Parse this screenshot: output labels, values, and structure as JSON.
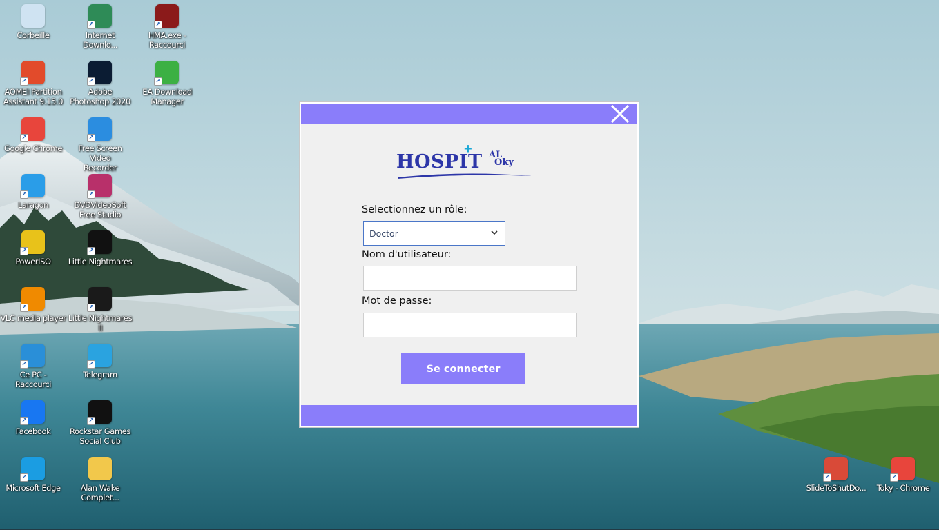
{
  "desktop": {
    "icons": [
      {
        "label": "Corbeille",
        "icon": "recycle-bin-icon",
        "color": "#cfe3f2"
      },
      {
        "label": "Internet\nDownlo...",
        "icon": "idm-icon",
        "color": "#2e8b57"
      },
      {
        "label": "HMA.exe -\nRaccourci",
        "icon": "hma-icon",
        "color": "#8b1a1a"
      },
      {
        "label": "AOMEI Partition\nAssistant 9.15.0",
        "icon": "aomei-icon",
        "color": "#e24b2b"
      },
      {
        "label": "Adobe\nPhotoshop 2020",
        "icon": "photoshop-icon",
        "color": "#0b1c33"
      },
      {
        "label": "EA Download\nManager",
        "icon": "ea-icon",
        "color": "#3cb043"
      },
      {
        "label": "Google Chrome",
        "icon": "chrome-icon",
        "color": "#e8453c"
      },
      {
        "label": "Free Screen Video\nRecorder",
        "icon": "screen-recorder-icon",
        "color": "#2b8de0"
      },
      {
        "label": "Laragon",
        "icon": "laragon-icon",
        "color": "#2a9de8"
      },
      {
        "label": "DVDVideoSoft\nFree Studio",
        "icon": "dvdvideosoft-icon",
        "color": "#b8306a"
      },
      {
        "label": "PowerISO",
        "icon": "poweriso-icon",
        "color": "#e8c21a"
      },
      {
        "label": "Little Nightmares",
        "icon": "little-nightmares-icon",
        "color": "#111111"
      },
      {
        "label": "VLC media player",
        "icon": "vlc-icon",
        "color": "#f08a00"
      },
      {
        "label": "Little Nightmares\nII",
        "icon": "little-nightmares-2-icon",
        "color": "#1a1a1a"
      },
      {
        "label": "Ce PC -\nRaccourci",
        "icon": "this-pc-icon",
        "color": "#2a8fd8"
      },
      {
        "label": "Telegram",
        "icon": "telegram-icon",
        "color": "#2aa3e0"
      },
      {
        "label": "Facebook",
        "icon": "facebook-icon",
        "color": "#1877f2"
      },
      {
        "label": "Rockstar Games\nSocial Club",
        "icon": "rockstar-icon",
        "color": "#111111"
      },
      {
        "label": "Microsoft Edge",
        "icon": "edge-icon",
        "color": "#1b9de2"
      },
      {
        "label": "Alan Wake\nComplet...",
        "icon": "folder-icon",
        "color": "#f2c84b"
      },
      {
        "label": "SlideToShutDo...",
        "icon": "slide-to-shutdown-icon",
        "color": "#d94a38"
      },
      {
        "label": "Toky - Chrome",
        "icon": "chrome-profile-icon",
        "color": "#e8453c"
      }
    ]
  },
  "login": {
    "logo": {
      "main": "HOSPIT",
      "top": "AL",
      "bottom": "Oky",
      "cross": "+"
    },
    "role_label": "Selectionnez un rôle:",
    "role_value": "Doctor",
    "username_label": "Nom d'utilisateur:",
    "username_value": "",
    "password_label": "Mot de passe:",
    "password_value": "",
    "submit_label": "Se connecter",
    "accent_color": "#8a7dfa"
  }
}
